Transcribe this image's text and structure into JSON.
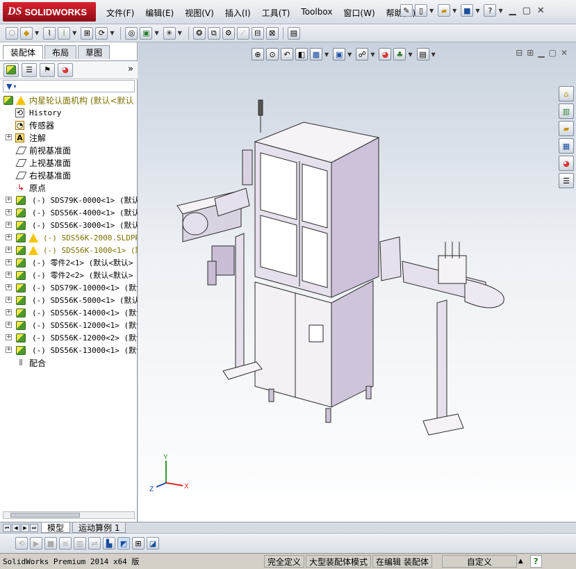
{
  "app": {
    "brand_prefix": "DS",
    "brand_name": "SOLIDWORKS"
  },
  "menu": [
    "文件(F)",
    "编辑(E)",
    "视图(V)",
    "插入(I)",
    "工具(T)",
    "Toolbox",
    "窗口(W)",
    "帮助(H)"
  ],
  "manager_tabs": [
    "装配体",
    "布局",
    "草图"
  ],
  "tree": {
    "root": "内星轮认面机构  (默认<默认",
    "items": [
      {
        "label": "History",
        "icon": "history-icon"
      },
      {
        "label": "传感器",
        "icon": "sensor-icon"
      },
      {
        "label": "注解",
        "icon": "annotation-icon",
        "expandable": true
      },
      {
        "label": "前视基准面",
        "icon": "plane-icon"
      },
      {
        "label": "上视基准面",
        "icon": "plane-icon"
      },
      {
        "label": "右视基准面",
        "icon": "plane-icon"
      },
      {
        "label": "原点",
        "icon": "origin-icon"
      }
    ],
    "components": [
      {
        "label": "(-) SDS79K-0000<1> (默认<",
        "warning": false
      },
      {
        "label": "(-) SDS56K-4000<1> (默认<",
        "warning": false
      },
      {
        "label": "(-) SDS56K-3000<1> (默认<",
        "warning": false
      },
      {
        "label": "(-) SDS56K-2000.SLDPRT<",
        "warning": true
      },
      {
        "label": "(-) SDS56K-1000<1> (默认",
        "warning": true
      },
      {
        "label": "(-) 零件2<1> (默认<默认>",
        "warning": false
      },
      {
        "label": "(-) 零件2<2> (默认<默认>",
        "warning": false
      },
      {
        "label": "(-) SDS79K-10000<1> (默认",
        "warning": false
      },
      {
        "label": "(-) SDS56K-5000<1> (默认<",
        "warning": false
      },
      {
        "label": "(-) SDS56K-14000<1> (默认",
        "warning": false
      },
      {
        "label": "(-) SDS56K-12000<1> (默认",
        "warning": false
      },
      {
        "label": "(-) SDS56K-12000<2> (默认",
        "warning": false
      },
      {
        "label": "(-) SDS56K-13000<1> (默认",
        "warning": false
      }
    ],
    "mates": "配合"
  },
  "bottom_tabs": [
    "模型",
    "运动算例 1"
  ],
  "triad": {
    "x": "X",
    "y": "Y",
    "z": "Z"
  },
  "status": {
    "product": "SolidWorks Premium 2014 x64 版",
    "fully_defined": "完全定义",
    "large_assembly": "大型装配体模式",
    "editing": "在编辑 装配体",
    "custom": "自定义",
    "help": "?"
  },
  "colors": {
    "brand_red": "#c8102e",
    "accent_blue": "#1a4fa0",
    "model_frame": "#c9bcd6",
    "warning_text": "#7c7000"
  }
}
